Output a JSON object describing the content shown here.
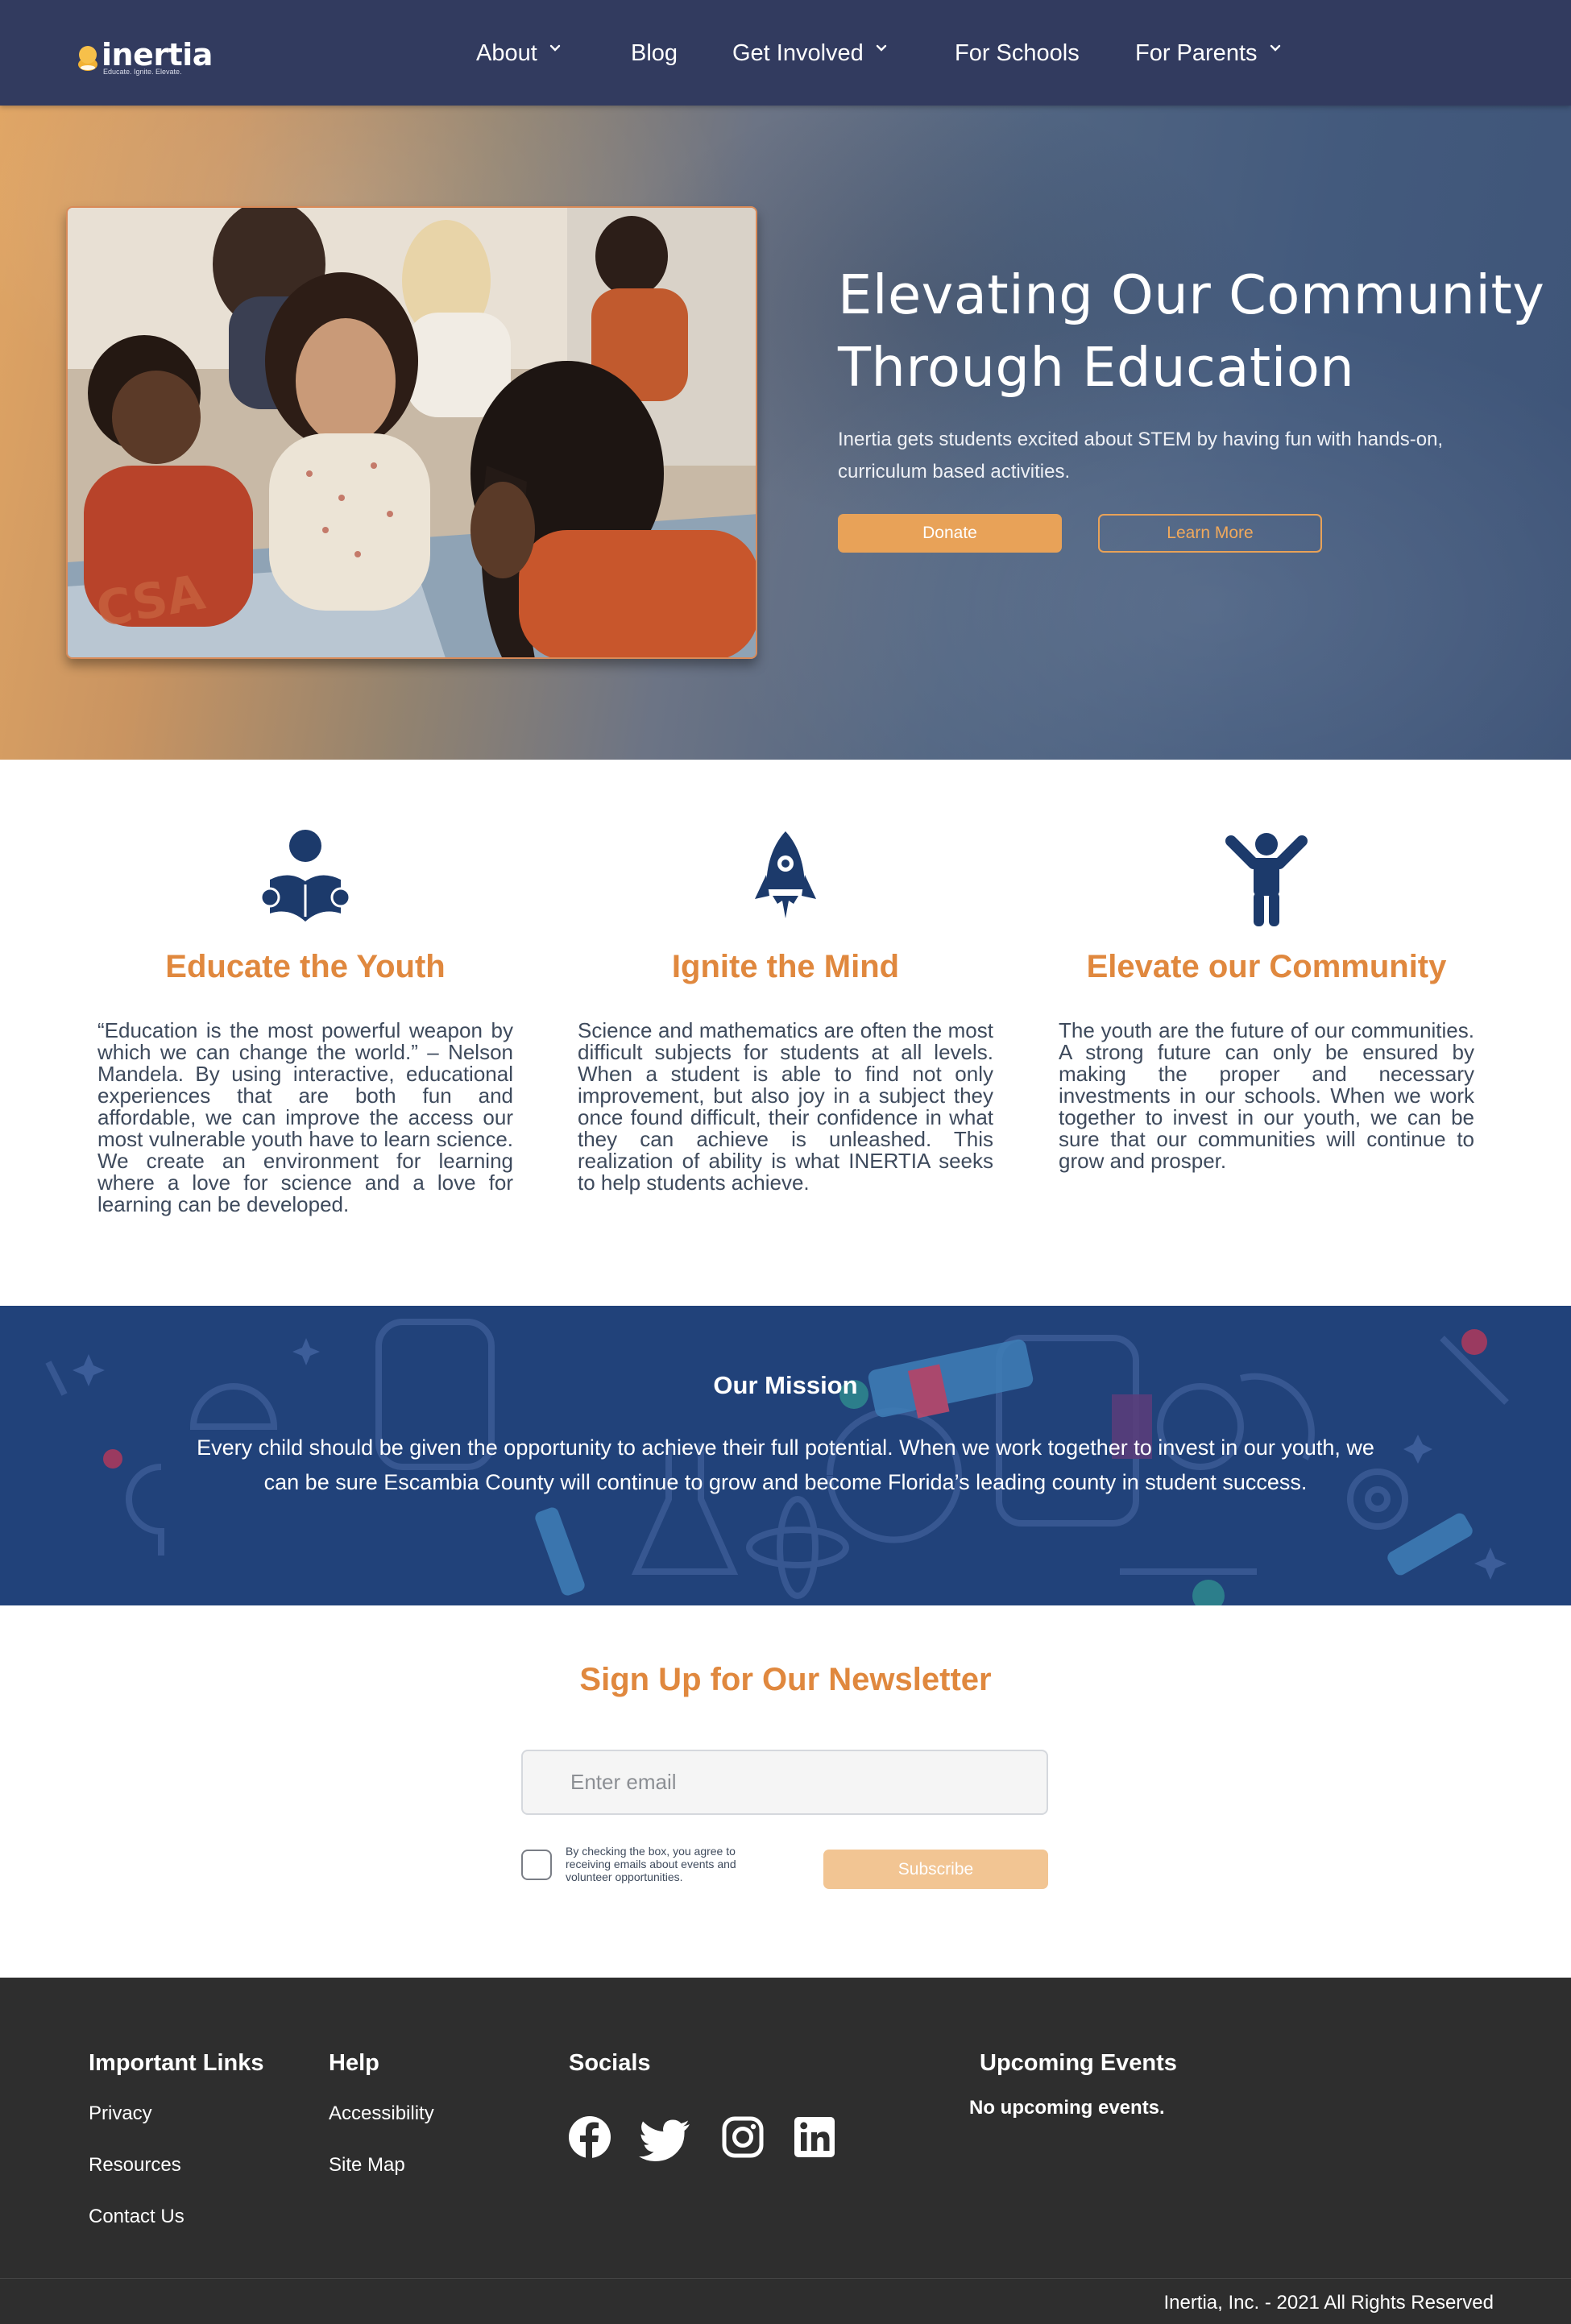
{
  "brand": {
    "name": "inertia",
    "tagline": "Educate. Ignite. Elevate."
  },
  "nav": {
    "items": [
      {
        "label": "About",
        "dropdown": true
      },
      {
        "label": "Blog",
        "dropdown": false
      },
      {
        "label": "Get Involved",
        "dropdown": true
      },
      {
        "label": "For Schools",
        "dropdown": false
      },
      {
        "label": "For Parents",
        "dropdown": true
      }
    ]
  },
  "hero": {
    "title": "Elevating Our Community Through Education",
    "subtitle": "Inertia gets students excited about STEM by having fun with hands-on, curriculum based activities.",
    "donate_label": "Donate",
    "learn_more_label": "Learn More"
  },
  "pillars": [
    {
      "icon": "reading-person-icon",
      "title": "Educate the Youth",
      "text": "“Education is the most powerful weapon by which we can change the world.” – Nelson Mandela. By using interactive, educational experiences that are both fun and affordable, we can improve the access our most vulnerable youth have to learn science. We create an environment for learning where a love for science and a love for learning can be developed."
    },
    {
      "icon": "rocket-icon",
      "title": "Ignite the Mind",
      "text": "Science and mathematics are often the most difficult subjects for students at all levels. When a student is able to find not only improvement, but also joy in a subject they once found difficult, their confidence in what they can achieve is unleashed. This realization of ability is what INERTIA seeks to help students achieve."
    },
    {
      "icon": "person-raised-arms-icon",
      "title": "Elevate our Community",
      "text": "The youth are the future of our communities. A strong future can only be ensured by making the proper and necessary investments in our schools. When we work together to invest in our youth, we can be sure that our communities will continue to grow and prosper."
    }
  ],
  "mission": {
    "title": "Our Mission",
    "text": "Every child should be given the opportunity to achieve their full potential. When we work together to invest in our youth, we can be sure Escambia County will continue to grow and become Florida’s leading county in student success."
  },
  "newsletter": {
    "title": "Sign Up for Our Newsletter",
    "email_placeholder": "Enter email",
    "consent_text": "By checking the box, you agree to receiving emails about events and volunteer opportunities.",
    "subscribe_label": "Subscribe"
  },
  "footer": {
    "important_links": {
      "heading": "Important Links",
      "links": [
        "Privacy",
        "Resources",
        "Contact Us"
      ]
    },
    "help": {
      "heading": "Help",
      "links": [
        "Accessibility",
        "Site Map"
      ]
    },
    "socials": {
      "heading": "Socials",
      "icons": [
        "facebook-icon",
        "twitter-icon",
        "instagram-icon",
        "linkedin-icon"
      ]
    },
    "events": {
      "heading": "Upcoming Events",
      "empty_text": "No upcoming events."
    },
    "copyright": "Inertia, Inc. - 2021 All Rights Reserved"
  },
  "colors": {
    "nav_bg": "#323b5f",
    "accent_orange": "#e8a258",
    "heading_orange": "#e0883e",
    "icon_navy": "#1c3a6b",
    "mission_bg": "#21427a",
    "footer_bg": "#2e2e2e"
  }
}
